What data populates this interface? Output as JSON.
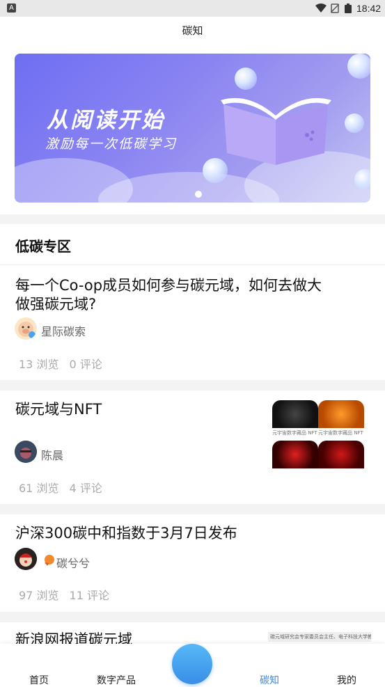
{
  "status_bar": {
    "time": "18:42"
  },
  "header": {
    "title": "碳知"
  },
  "banner": {
    "headline": "从阅读开始",
    "subline": "激励每一次低碳学习"
  },
  "section": {
    "title": "低碳专区"
  },
  "articles": [
    {
      "title_line1": "每一个Co-op成员如何参与碳元域，如何去做大",
      "title_line2": "做强碳元域?",
      "author": "星际碳索",
      "views": "13 浏览",
      "comments": "0 评论"
    },
    {
      "title_line1": "碳元域与NFT",
      "author": "陈晨",
      "views": "61 浏览",
      "comments": "4 评论",
      "thumb_caption": "元宇宙数字藏品 NFT"
    },
    {
      "title_line1": "沪深300碳中和指数于3月7日发布",
      "author": "碳兮兮",
      "views": "97 浏览",
      "comments": "11 评论"
    },
    {
      "title_line1": "新浪网报道碳元域",
      "thumb_caption": "碳元域研究会专家委员会主任、电子科技大学教"
    }
  ],
  "tabs": [
    {
      "label": "首页"
    },
    {
      "label": "数字产品"
    },
    {
      "label": "碳知"
    },
    {
      "label": "我的"
    }
  ],
  "colors": {
    "accent": "#3a8ae6",
    "banner_start": "#6e6ef2",
    "banner_end": "#c4c6f4"
  }
}
